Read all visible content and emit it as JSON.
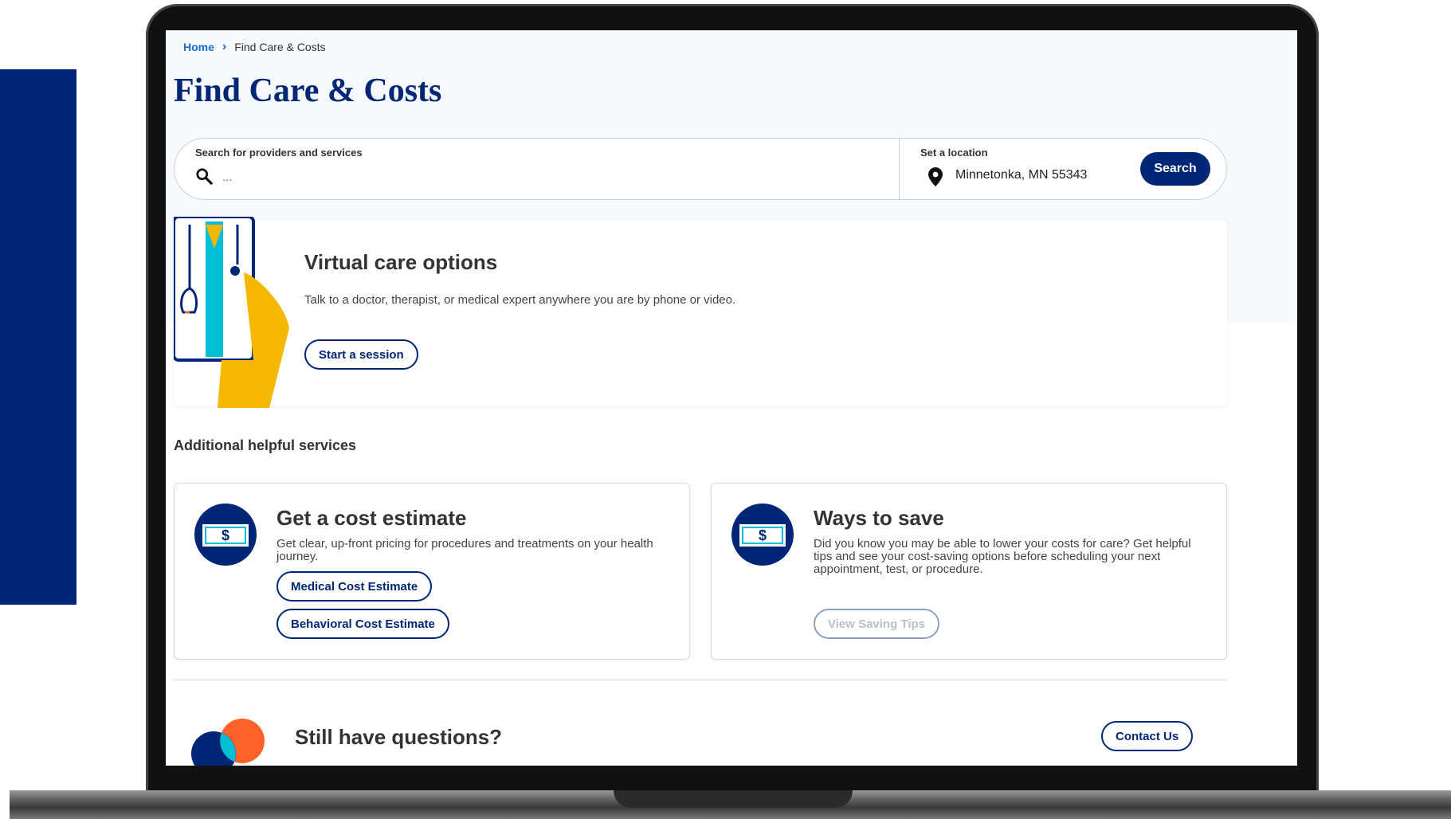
{
  "breadcrumb": {
    "home": "Home",
    "current": "Find Care & Costs"
  },
  "page": {
    "title": "Find Care & Costs"
  },
  "search": {
    "label": "Search for providers and services",
    "placeholder": "...",
    "location_label": "Set a location",
    "location_value": "Minnetonka, MN 55343",
    "button": "Search"
  },
  "virtual_care": {
    "title": "Virtual care options",
    "description": "Talk to a doctor, therapist, or medical expert anywhere you are by phone or video.",
    "button": "Start a session"
  },
  "additional": {
    "title": "Additional helpful services",
    "cards": [
      {
        "title": "Get a cost estimate",
        "description": "Get clear, up-front pricing for procedures and treatments on your health journey.",
        "buttons": [
          "Medical Cost Estimate",
          "Behavioral Cost Estimate"
        ]
      },
      {
        "title": "Ways to save",
        "description": "Did you know you may be able to lower your costs for care? Get helpful tips and see your cost-saving options before scheduling your next appointment, test, or procedure.",
        "buttons": [
          "View Saving Tips"
        ]
      }
    ]
  },
  "questions": {
    "title": "Still have questions?",
    "button": "Contact Us"
  },
  "icons": {
    "money": "$"
  },
  "colors": {
    "brand": "#002677",
    "link": "#196ecf",
    "accent_orange": "#ff612b",
    "accent_teal": "#00bed5",
    "accent_yellow": "#f5b700"
  }
}
